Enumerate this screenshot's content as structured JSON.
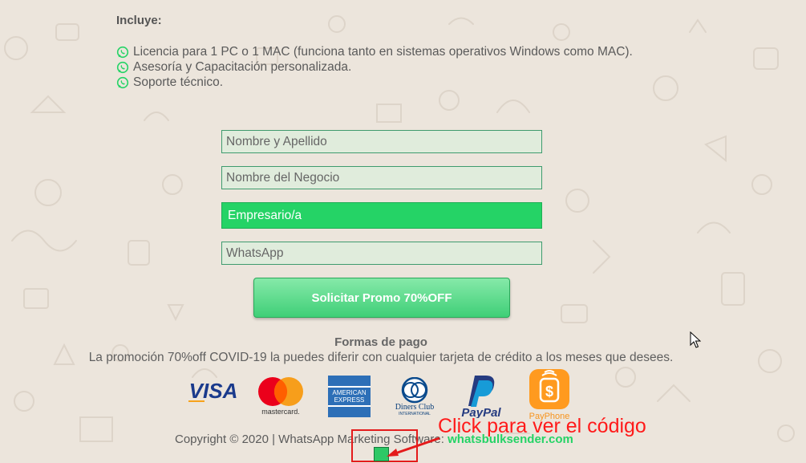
{
  "includes": {
    "title": "Incluye:",
    "items": [
      {
        "icon": "whatsapp-icon",
        "text": "Licencia para 1 PC o 1 MAC (funciona tanto en sistemas operativos Windows como MAC)."
      },
      {
        "icon": "whatsapp-icon",
        "text": "Asesoría y Capacitación personalizada."
      },
      {
        "icon": "whatsapp-icon",
        "text": "Soporte técnico."
      }
    ]
  },
  "form": {
    "name_placeholder": "Nombre y Apellido",
    "business_placeholder": "Nombre del Negocio",
    "type_selected": "Empresario/a",
    "whatsapp_placeholder": "WhatsApp",
    "submit_label": "Solicitar Promo 70%OFF"
  },
  "payment": {
    "title": "Formas de pago",
    "text": "La promoción 70%off COVID-19 la puedes diferir con cualquier tarjeta de crédito a los meses que desees.",
    "logos": {
      "visa": "VISA",
      "mastercard": "mastercard.",
      "amex_top": "AMERICAN",
      "amex_bottom": "EXPRESS",
      "diners_name": "Diners Club",
      "diners_sub": "INTERNATIONAL",
      "paypal": "PayPal",
      "payphone": "PayPhone"
    }
  },
  "footer": {
    "copyright": "Copyright © 2020 | WhatsApp Marketing Software: ",
    "link": "whatsbulksender.com"
  },
  "annotation": {
    "text": "Click para ver el código"
  },
  "colors": {
    "background": "#ece5dc",
    "whatsapp_green": "#25d366",
    "annotation_red": "#ff1a1a"
  }
}
